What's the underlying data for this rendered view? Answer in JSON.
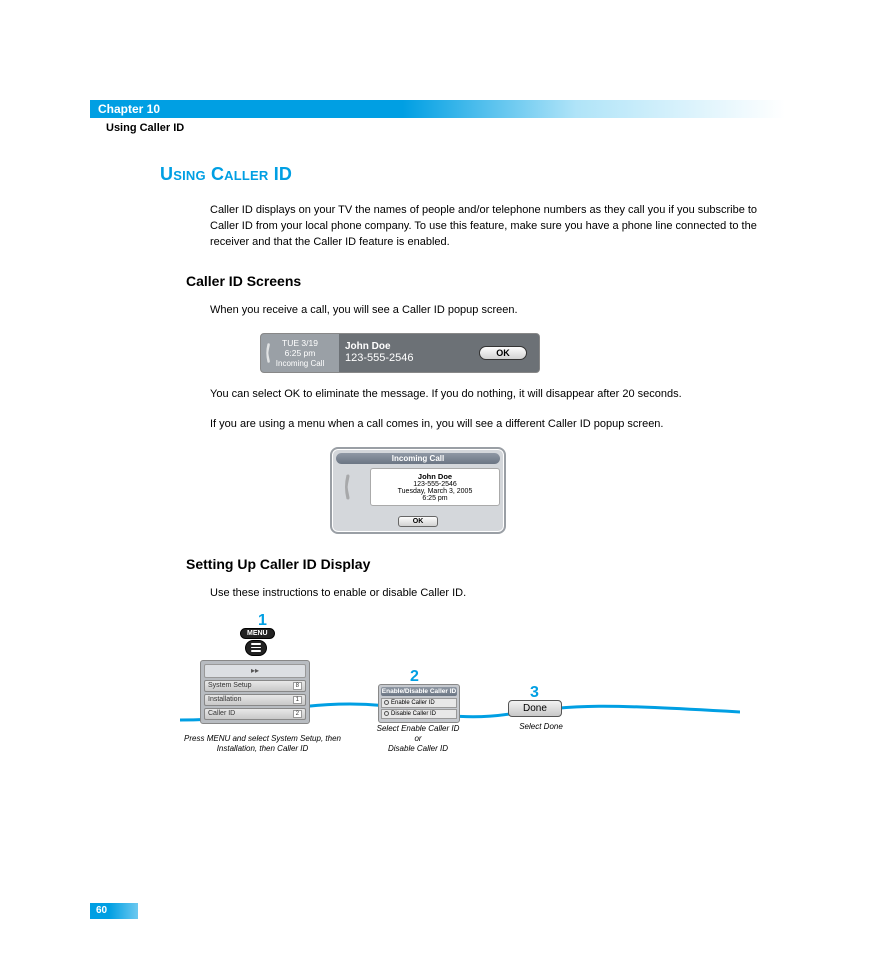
{
  "chapter_label": "Chapter 10",
  "section_label": "Using Caller ID",
  "main_heading": "Using Caller ID",
  "intro_para": "Caller ID displays on your TV the names of people and/or telephone numbers as they call you if you subscribe to Caller ID from your local phone company. To use this feature, make sure you have a phone line connected to the receiver and that the Caller ID feature is enabled.",
  "sub_heading_1": "Caller ID Screens",
  "screens_para_1": "When you receive a call, you will see a Caller ID popup screen.",
  "popup1": {
    "date": "TUE 3/19",
    "time": "6:25 pm",
    "incoming": "Incoming Call",
    "name": "John Doe",
    "number": "123-555-2546",
    "ok": "OK"
  },
  "screens_para_2": "You can select OK to eliminate the message. If you do nothing, it will disappear after 20 seconds.",
  "screens_para_3": "If you are using a menu when a call comes in, you will see a different Caller ID popup screen.",
  "popup2": {
    "header": "Incoming Call",
    "name": "John Doe",
    "number": "123-555-2546",
    "datetime": "Tuesday, March 3, 2005",
    "time": "6:25 pm",
    "ok": "OK"
  },
  "sub_heading_2": "Setting Up Caller ID Display",
  "setup_para": "Use these instructions to enable or disable Caller ID.",
  "steps": {
    "n1": "1",
    "n2": "2",
    "n3": "3",
    "menu_label": "MENU",
    "menu_rows": {
      "r1": "System Setup",
      "r1k": "8",
      "r2": "Installation",
      "r2k": "1",
      "r3": "Caller ID",
      "r3k": "2"
    },
    "caption1": "Press MENU and select System Setup, then Installation, then Caller ID",
    "enable_header": "Enable/Disable Caller ID",
    "enable_opt1": "Enable Caller ID",
    "enable_opt2": "Disable Caller ID",
    "caption2_l1": "Select Enable Caller ID",
    "caption2_l2": "or",
    "caption2_l3": "Disable Caller ID",
    "done": "Done",
    "caption3": "Select Done"
  },
  "page_number": "60"
}
